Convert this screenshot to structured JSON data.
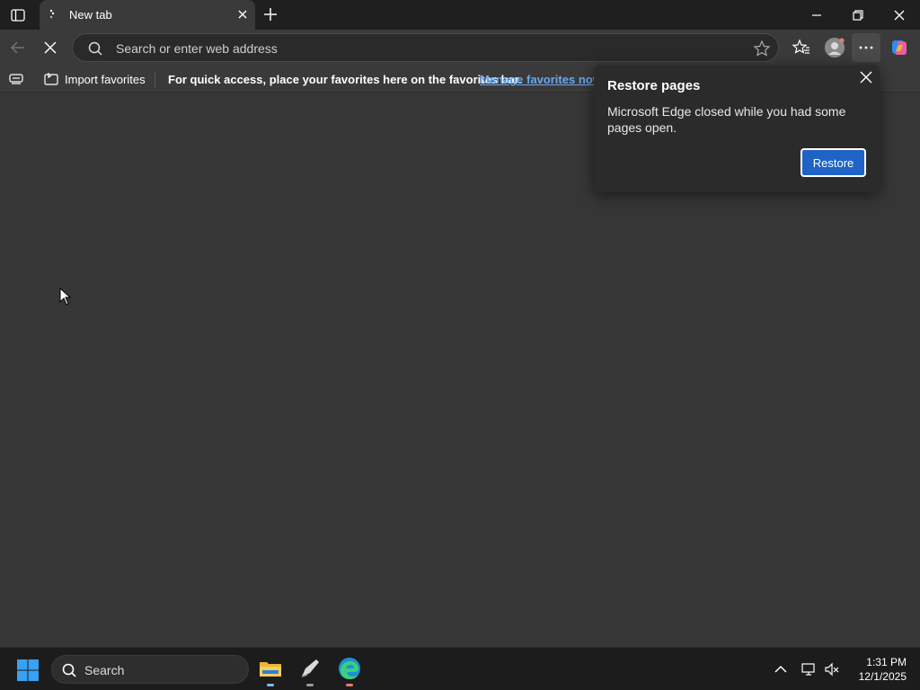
{
  "browser": {
    "tab": {
      "title": "New tab"
    },
    "address_bar": {
      "placeholder": "Search or enter web address"
    },
    "favorites_bar": {
      "import_label": "Import favorites",
      "hint": "For quick access, place your favorites here on the favorites bar.",
      "manage_link": "Manage favorites now"
    },
    "restore_popup": {
      "title": "Restore pages",
      "message": "Microsoft Edge closed while you had some pages open.",
      "restore_label": "Restore"
    }
  },
  "taskbar": {
    "search_label": "Search",
    "clock_time": "1:31 PM",
    "clock_date": "12/1/2025"
  },
  "colors": {
    "accent": "#1f63c6",
    "link": "#6aa8ec",
    "page_bg": "#363636"
  }
}
